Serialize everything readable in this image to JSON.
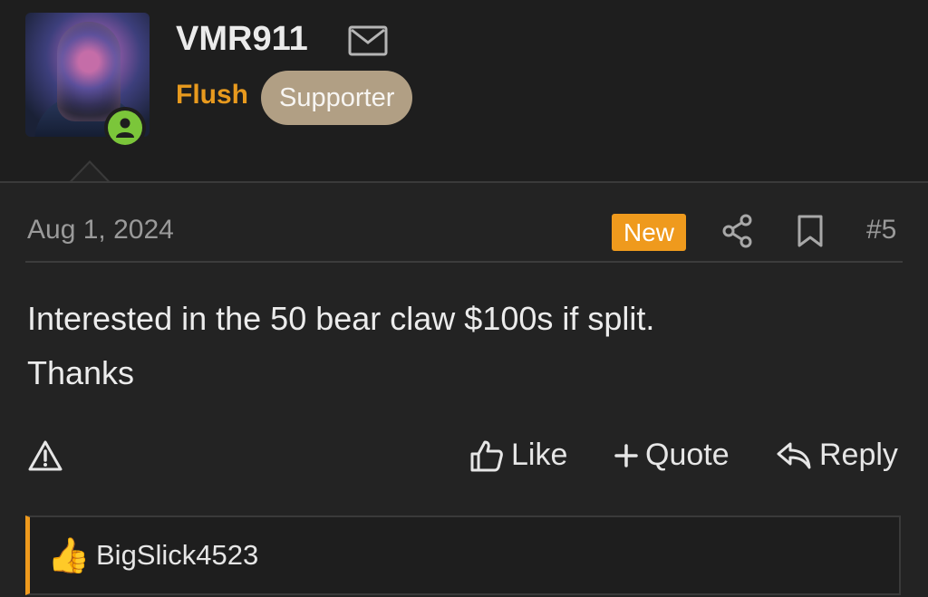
{
  "user": {
    "username": "VMR911",
    "title": "Flush",
    "badge": "Supporter"
  },
  "post": {
    "date": "Aug 1, 2024",
    "new_label": "New",
    "number": "#5",
    "body_line1": "Interested in the 50 bear claw $100s if split.",
    "body_line2": "Thanks"
  },
  "actions": {
    "like": "Like",
    "quote": "Quote",
    "reply": "Reply"
  },
  "reactions": {
    "emoji": "👍",
    "users": "BigSlick4523"
  },
  "icons": [
    "mail-icon",
    "share-icon",
    "bookmark-icon",
    "report-icon",
    "thumbs-up-icon",
    "plus-icon",
    "reply-icon",
    "online-status-icon"
  ],
  "colors": {
    "accent": "#ef9a1d",
    "online": "#7bc63a",
    "badge": "#b19f84",
    "background": "#232323"
  }
}
